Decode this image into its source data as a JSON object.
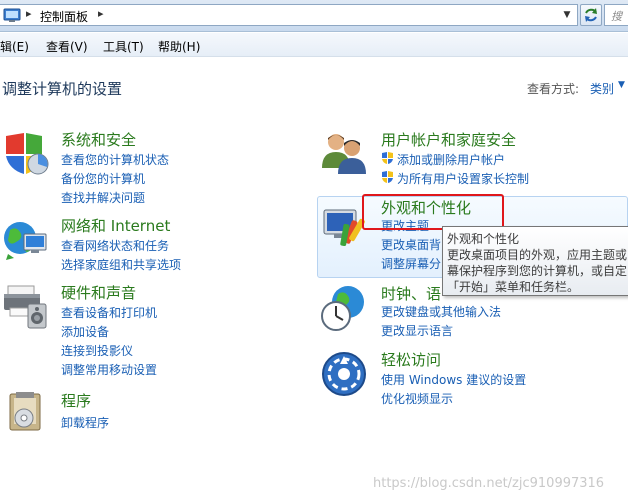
{
  "address_bar": {
    "separator": "▸",
    "crumb": "控制面板",
    "separator2": "▸",
    "dropdown_glyph": "▼",
    "search_placeholder": "搜"
  },
  "menu": [
    "辑(E)",
    "查看(V)",
    "工具(T)",
    "帮助(H)"
  ],
  "header": {
    "title": "调整计算机的设置",
    "view_label": "查看方式:",
    "view_value": "类别",
    "view_arrow": "▼"
  },
  "categories": {
    "system": {
      "title": "系统和安全",
      "links": [
        "查看您的计算机状态",
        "备份您的计算机",
        "查找并解决问题"
      ]
    },
    "network": {
      "title": "网络和 Internet",
      "links": [
        "查看网络状态和任务",
        "选择家庭组和共享选项"
      ]
    },
    "hardware": {
      "title": "硬件和声音",
      "links": [
        "查看设备和打印机",
        "添加设备",
        "连接到投影仪",
        "调整常用移动设置"
      ]
    },
    "programs": {
      "title": "程序",
      "links": [
        "卸载程序"
      ]
    },
    "users": {
      "title": "用户帐户和家庭安全",
      "links": [
        "添加或删除用户帐户",
        "为所有用户设置家长控制"
      ]
    },
    "appearance": {
      "title": "外观和个性化",
      "links": [
        "更改主题",
        "更改桌面背",
        "调整屏幕分"
      ]
    },
    "clock": {
      "title": "时钟、语",
      "links": [
        "更改键盘或其他输入法",
        "更改显示语言"
      ]
    },
    "ease": {
      "title": "轻松访问",
      "links": [
        "使用 Windows 建议的设置",
        "优化视频显示"
      ]
    }
  },
  "tooltip": {
    "lines": [
      "外观和个性化",
      "更改桌面项目的外观，应用主题或",
      "幕保护程序到您的计算机，或自定",
      "「开始」菜单和任务栏。"
    ]
  },
  "watermark": "https://blog.csdn.net/zjc910997316",
  "colors": {
    "category_title": "#2a7a1d",
    "link": "#1a5fb4",
    "highlight_border": "#e0171b"
  }
}
